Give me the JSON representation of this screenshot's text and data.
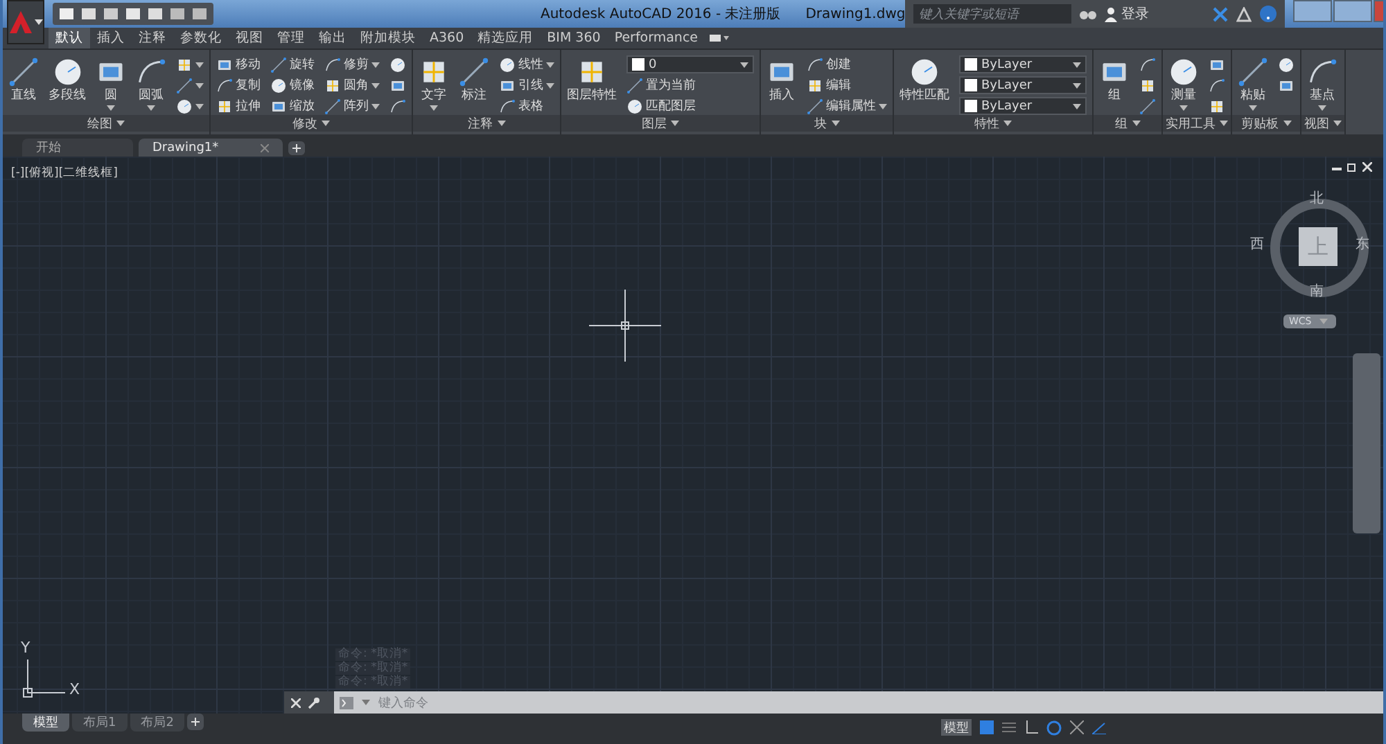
{
  "title_bar": {
    "title": "Autodesk AutoCAD 2016 - 未注册版",
    "file_name": "Drawing1.dwg",
    "search_placeholder": "键入关键字或短语",
    "login": "登录"
  },
  "ribbon_tabs": [
    {
      "label": "默认",
      "selected": true
    },
    {
      "label": "插入",
      "selected": false
    },
    {
      "label": "注释",
      "selected": false
    },
    {
      "label": "参数化",
      "selected": false
    },
    {
      "label": "视图",
      "selected": false
    },
    {
      "label": "管理",
      "selected": false
    },
    {
      "label": "输出",
      "selected": false
    },
    {
      "label": "附加模块",
      "selected": false
    },
    {
      "label": "A360",
      "selected": false
    },
    {
      "label": "精选应用",
      "selected": false
    },
    {
      "label": "BIM 360",
      "selected": false
    },
    {
      "label": "Performance",
      "selected": false
    }
  ],
  "panels": [
    {
      "title": "绘图",
      "columns": [
        {
          "kind": "large",
          "label": "直线",
          "dropdown": false
        },
        {
          "kind": "large",
          "label": "多段线",
          "dropdown": false
        },
        {
          "kind": "large",
          "label": "圆",
          "dropdown": true
        },
        {
          "kind": "large",
          "label": "圆弧",
          "dropdown": true
        },
        {
          "kind": "stack",
          "items": [
            {
              "kind": "icon",
              "dropdown": true
            },
            {
              "kind": "icon",
              "dropdown": true
            },
            {
              "kind": "icon",
              "dropdown": true
            }
          ]
        }
      ]
    },
    {
      "title": "修改",
      "columns": [
        {
          "kind": "stack",
          "items": [
            {
              "kind": "tool",
              "label": "移动",
              "dropdown": false
            },
            {
              "kind": "tool",
              "label": "复制",
              "dropdown": false
            },
            {
              "kind": "tool",
              "label": "拉伸",
              "dropdown": false
            }
          ]
        },
        {
          "kind": "stack",
          "items": [
            {
              "kind": "tool",
              "label": "旋转",
              "dropdown": false
            },
            {
              "kind": "tool",
              "label": "镜像",
              "dropdown": false
            },
            {
              "kind": "tool",
              "label": "缩放",
              "dropdown": false
            }
          ]
        },
        {
          "kind": "stack",
          "items": [
            {
              "kind": "tool",
              "label": "修剪",
              "dropdown": true
            },
            {
              "kind": "tool",
              "label": "圆角",
              "dropdown": true
            },
            {
              "kind": "tool",
              "label": "阵列",
              "dropdown": true
            }
          ]
        },
        {
          "kind": "stack",
          "items": [
            {
              "kind": "icon",
              "dropdown": false
            },
            {
              "kind": "icon",
              "dropdown": false
            },
            {
              "kind": "icon",
              "dropdown": false
            }
          ]
        }
      ]
    },
    {
      "title": "注释",
      "columns": [
        {
          "kind": "large",
          "label": "文字",
          "dropdown": true
        },
        {
          "kind": "large",
          "label": "标注",
          "dropdown": false
        },
        {
          "kind": "stack",
          "items": [
            {
              "kind": "tool",
              "label": "线性",
              "dropdown": true
            },
            {
              "kind": "tool",
              "label": "引线",
              "dropdown": true
            },
            {
              "kind": "tool",
              "label": "表格",
              "dropdown": false
            }
          ]
        }
      ]
    },
    {
      "title": "图层",
      "columns": [
        {
          "kind": "large",
          "label": "图层特性",
          "dropdown": false
        },
        {
          "kind": "stack",
          "items": [
            {
              "kind": "combo",
              "value": "0"
            },
            {
              "kind": "tool",
              "label": "置为当前",
              "dropdown": false
            },
            {
              "kind": "tool",
              "label": "匹配图层",
              "dropdown": false
            }
          ]
        }
      ]
    },
    {
      "title": "块",
      "columns": [
        {
          "kind": "large",
          "label": "插入",
          "dropdown": false
        },
        {
          "kind": "stack",
          "items": [
            {
              "kind": "tool",
              "label": "创建",
              "dropdown": false
            },
            {
              "kind": "tool",
              "label": "编辑",
              "dropdown": false
            },
            {
              "kind": "tool",
              "label": "编辑属性",
              "dropdown": true
            }
          ]
        }
      ]
    },
    {
      "title": "特性",
      "columns": [
        {
          "kind": "large",
          "label": "特性匹配",
          "dropdown": false
        },
        {
          "kind": "stack",
          "items": [
            {
              "kind": "combo",
              "value": "ByLayer"
            },
            {
              "kind": "combo",
              "value": "ByLayer"
            },
            {
              "kind": "combo",
              "value": "ByLayer"
            }
          ]
        }
      ]
    },
    {
      "title": "组",
      "columns": [
        {
          "kind": "large",
          "label": "组",
          "dropdown": false
        },
        {
          "kind": "stack",
          "items": [
            {
              "kind": "icon",
              "dropdown": false
            },
            {
              "kind": "icon",
              "dropdown": false
            },
            {
              "kind": "icon",
              "dropdown": false
            }
          ]
        }
      ]
    },
    {
      "title": "实用工具",
      "columns": [
        {
          "kind": "large",
          "label": "测量",
          "dropdown": true
        },
        {
          "kind": "stack",
          "items": [
            {
              "kind": "icon",
              "dropdown": false
            },
            {
              "kind": "icon",
              "dropdown": false
            },
            {
              "kind": "icon",
              "dropdown": false
            }
          ]
        }
      ]
    },
    {
      "title": "剪贴板",
      "columns": [
        {
          "kind": "large",
          "label": "粘贴",
          "dropdown": true
        },
        {
          "kind": "stack",
          "items": [
            {
              "kind": "icon",
              "dropdown": false
            },
            {
              "kind": "icon",
              "dropdown": false
            }
          ]
        }
      ]
    },
    {
      "title": "视图",
      "columns": [
        {
          "kind": "large",
          "label": "基点",
          "dropdown": true
        }
      ]
    }
  ],
  "doc_tabs": [
    {
      "label": "开始",
      "selected": false
    },
    {
      "label": "Drawing1*",
      "selected": true
    }
  ],
  "viewport_label": "[-][俯视][二维线框]",
  "viewcube": {
    "north": "北",
    "west": "西",
    "east": "东",
    "south": "南",
    "face": "上",
    "ucs": "WCS"
  },
  "ucs_icon": {
    "y": "Y",
    "x": "X"
  },
  "command_history": [
    "命令: *取消*",
    "命令: *取消*",
    "命令: *取消*"
  ],
  "command_line": {
    "placeholder": "键入命令"
  },
  "layout_tabs": [
    {
      "label": "模型",
      "selected": true
    },
    {
      "label": "布局1",
      "selected": false
    },
    {
      "label": "布局2",
      "selected": false
    }
  ],
  "status_bar": {
    "mode": "模型"
  }
}
